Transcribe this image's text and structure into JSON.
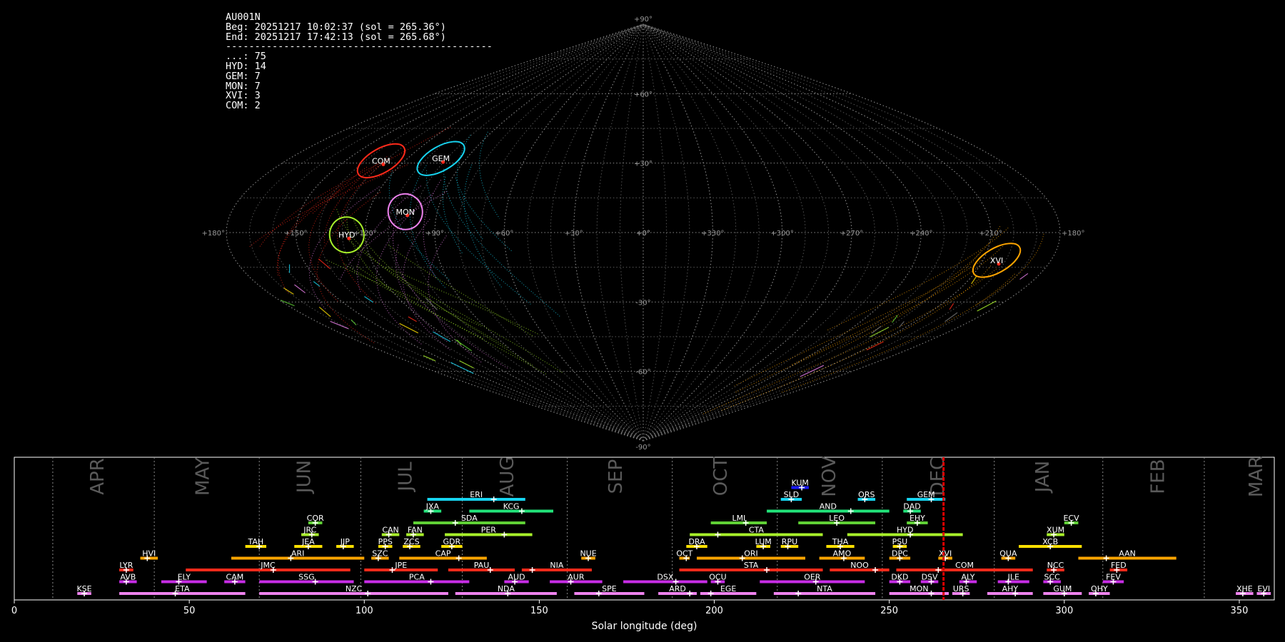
{
  "info": {
    "station": "AU001N",
    "begin": "Beg: 20251217 10:02:37 (sol = 265.36°)",
    "end": "End: 20251217 17:42:13 (sol = 265.68°)",
    "separator": "----------------------------------------------",
    "counts": [
      "...: 75",
      "HYD: 14",
      "GEM: 7",
      "MON: 7",
      "XVI: 3",
      "COM: 2"
    ]
  },
  "sky_map": {
    "projection": "sinusoidal",
    "lon_labels": [
      "+180°",
      "+150°",
      "+120°",
      "+90°",
      "+60°",
      "+30°",
      "+0°",
      "+330°",
      "+300°",
      "+270°",
      "+240°",
      "+210°",
      "+180°"
    ],
    "lat_labels": [
      "+90°",
      "+60°",
      "+30°",
      "+0°",
      "-30°",
      "-60°",
      "-90°"
    ],
    "showers": [
      {
        "code": "COM",
        "lon": 132,
        "lat": 31,
        "color": "#ff2a1a"
      },
      {
        "code": "GEM",
        "lon": 103,
        "lat": 32,
        "color": "#17d4f0"
      },
      {
        "code": "MON",
        "lon": 104,
        "lat": 9,
        "color": "#ee82ee"
      },
      {
        "code": "HYD",
        "lon": 128,
        "lat": -1,
        "color": "#a8f02a"
      },
      {
        "code": "XVI",
        "lon": 204,
        "lat": -12,
        "color": "#ffa500"
      }
    ]
  },
  "chart_data": {
    "type": "timeline",
    "xlabel": "Solar longitude (deg)",
    "xlim": [
      0,
      360
    ],
    "xticks": [
      0,
      50,
      100,
      150,
      200,
      250,
      300,
      350
    ],
    "current_sol": 265.5,
    "months": [
      {
        "label": "APR",
        "start": 11,
        "mid": 24
      },
      {
        "label": "MAY",
        "start": 40,
        "mid": 54
      },
      {
        "label": "JUN",
        "start": 70,
        "mid": 83
      },
      {
        "label": "JUL",
        "start": 99,
        "mid": 112
      },
      {
        "label": "AUG",
        "start": 128,
        "mid": 141
      },
      {
        "label": "SEP",
        "start": 158,
        "mid": 172
      },
      {
        "label": "OCT",
        "start": 188,
        "mid": 202
      },
      {
        "label": "NOV",
        "start": 218,
        "mid": 233
      },
      {
        "label": "DEC",
        "start": 248,
        "mid": 264
      },
      {
        "label": "JAN",
        "start": 280,
        "mid": 294
      },
      {
        "label": "FEB",
        "start": 311,
        "mid": 327
      },
      {
        "label": "MAR",
        "start": 340,
        "mid": 355
      }
    ],
    "showers": [
      {
        "code": "KUM",
        "start": 222,
        "end": 227,
        "peak": 225,
        "row": 9,
        "color": "#1a1aff"
      },
      {
        "code": "ERI",
        "start": 118,
        "end": 146,
        "peak": 137,
        "row": 8,
        "color": "#17d4f0"
      },
      {
        "code": "SLD",
        "start": 219,
        "end": 225,
        "peak": 222,
        "row": 8,
        "color": "#17d4f0"
      },
      {
        "code": "ORS",
        "start": 241,
        "end": 246,
        "peak": 243,
        "row": 8,
        "color": "#17d4f0"
      },
      {
        "code": "GEM",
        "start": 255,
        "end": 266,
        "peak": 262,
        "row": 8,
        "color": "#17d4f0"
      },
      {
        "code": "JXA",
        "start": 117,
        "end": 122,
        "peak": 119,
        "row": 7,
        "color": "#22e47a"
      },
      {
        "code": "KCG",
        "start": 130,
        "end": 154,
        "peak": 145,
        "row": 7,
        "color": "#22e47a"
      },
      {
        "code": "AND",
        "start": 215,
        "end": 250,
        "peak": 239,
        "row": 7,
        "color": "#22e47a"
      },
      {
        "code": "DAD",
        "start": 254,
        "end": 259,
        "peak": 256,
        "row": 7,
        "color": "#22e47a"
      },
      {
        "code": "COR",
        "start": 84,
        "end": 88,
        "peak": 86,
        "row": 6,
        "color": "#5fd035"
      },
      {
        "code": "SDA",
        "start": 114,
        "end": 146,
        "peak": 126,
        "row": 6,
        "color": "#5fd035"
      },
      {
        "code": "LMI",
        "start": 199,
        "end": 215,
        "peak": 209,
        "row": 6,
        "color": "#5fd035"
      },
      {
        "code": "LEO",
        "start": 224,
        "end": 246,
        "peak": 235,
        "row": 6,
        "color": "#5fd035"
      },
      {
        "code": "EHY",
        "start": 255,
        "end": 261,
        "peak": 258,
        "row": 6,
        "color": "#5fd035"
      },
      {
        "code": "ECV",
        "start": 300,
        "end": 304,
        "peak": 302,
        "row": 6,
        "color": "#5fd035"
      },
      {
        "code": "JRC",
        "start": 82,
        "end": 87,
        "peak": 85,
        "row": 5,
        "color": "#a8f02a"
      },
      {
        "code": "CAN",
        "start": 105,
        "end": 110,
        "peak": 107,
        "row": 5,
        "color": "#a8f02a"
      },
      {
        "code": "FAN",
        "start": 112,
        "end": 117,
        "peak": 114,
        "row": 5,
        "color": "#a8f02a"
      },
      {
        "code": "PER",
        "start": 123,
        "end": 148,
        "peak": 140,
        "row": 5,
        "color": "#a8f02a"
      },
      {
        "code": "CTA",
        "start": 193,
        "end": 231,
        "peak": 201,
        "row": 5,
        "color": "#a8f02a"
      },
      {
        "code": "HYD",
        "start": 238,
        "end": 271,
        "peak": 256,
        "row": 5,
        "color": "#a8f02a"
      },
      {
        "code": "XUM",
        "start": 295,
        "end": 300,
        "peak": 297,
        "row": 5,
        "color": "#a8f02a"
      },
      {
        "code": "TAH",
        "start": 66,
        "end": 72,
        "peak": 70,
        "row": 4,
        "color": "#ffe000"
      },
      {
        "code": "JEA",
        "start": 80,
        "end": 88,
        "peak": 84,
        "row": 4,
        "color": "#ffe000"
      },
      {
        "code": "JIP",
        "start": 92,
        "end": 97,
        "peak": 94,
        "row": 4,
        "color": "#ffe000"
      },
      {
        "code": "PPS",
        "start": 104,
        "end": 108,
        "peak": 106,
        "row": 4,
        "color": "#ffe000"
      },
      {
        "code": "ZCS",
        "start": 111,
        "end": 116,
        "peak": 113,
        "row": 4,
        "color": "#ffe000"
      },
      {
        "code": "GDR",
        "start": 122,
        "end": 128,
        "peak": 125,
        "row": 4,
        "color": "#ffe000"
      },
      {
        "code": "DRA",
        "start": 192,
        "end": 198,
        "peak": 195,
        "row": 4,
        "color": "#ffe000"
      },
      {
        "code": "LUM",
        "start": 212,
        "end": 216,
        "peak": 214,
        "row": 4,
        "color": "#ffe000"
      },
      {
        "code": "RPU",
        "start": 219,
        "end": 224,
        "peak": 221,
        "row": 4,
        "color": "#ffe000"
      },
      {
        "code": "THA",
        "start": 232,
        "end": 240,
        "peak": 236,
        "row": 4,
        "color": "#ffe000"
      },
      {
        "code": "PSU",
        "start": 251,
        "end": 255,
        "peak": 253,
        "row": 4,
        "color": "#ffe000"
      },
      {
        "code": "XCB",
        "start": 287,
        "end": 305,
        "peak": 296,
        "row": 4,
        "color": "#ffe000"
      },
      {
        "code": "HVI",
        "start": 36,
        "end": 41,
        "peak": 38,
        "row": 3,
        "color": "#ffa500"
      },
      {
        "code": "ARI",
        "start": 62,
        "end": 100,
        "peak": 79,
        "row": 3,
        "color": "#ffa500"
      },
      {
        "code": "SZC",
        "start": 102,
        "end": 107,
        "peak": 104,
        "row": 3,
        "color": "#ffa500"
      },
      {
        "code": "CAP",
        "start": 110,
        "end": 135,
        "peak": 127,
        "row": 3,
        "color": "#ffa500"
      },
      {
        "code": "NUE",
        "start": 162,
        "end": 166,
        "peak": 164,
        "row": 3,
        "color": "#ffa500"
      },
      {
        "code": "OCT",
        "start": 190,
        "end": 193,
        "peak": 192,
        "row": 3,
        "color": "#ffa500"
      },
      {
        "code": "ORI",
        "start": 195,
        "end": 226,
        "peak": 208,
        "row": 3,
        "color": "#ffa500"
      },
      {
        "code": "AMO",
        "start": 230,
        "end": 243,
        "peak": 237,
        "row": 3,
        "color": "#ffa500"
      },
      {
        "code": "DPC",
        "start": 250,
        "end": 256,
        "peak": 253,
        "row": 3,
        "color": "#ffa500"
      },
      {
        "code": "XVI",
        "start": 264,
        "end": 268,
        "peak": 266,
        "row": 3,
        "color": "#ffa500"
      },
      {
        "code": "QUA",
        "start": 282,
        "end": 286,
        "peak": 284,
        "row": 3,
        "color": "#ffa500"
      },
      {
        "code": "AAN",
        "start": 304,
        "end": 332,
        "peak": 312,
        "row": 3,
        "color": "#ffa500"
      },
      {
        "code": "LYR",
        "start": 30,
        "end": 34,
        "peak": 32,
        "row": 2,
        "color": "#ff2a1a"
      },
      {
        "code": "JMC",
        "start": 49,
        "end": 96,
        "peak": 74,
        "row": 2,
        "color": "#ff2a1a"
      },
      {
        "code": "JPE",
        "start": 100,
        "end": 121,
        "peak": 108,
        "row": 2,
        "color": "#ff2a1a"
      },
      {
        "code": "PAU",
        "start": 124,
        "end": 143,
        "peak": 136,
        "row": 2,
        "color": "#ff2a1a"
      },
      {
        "code": "NIA",
        "start": 145,
        "end": 165,
        "peak": 148,
        "row": 2,
        "color": "#ff2a1a"
      },
      {
        "code": "STA",
        "start": 190,
        "end": 231,
        "peak": 215,
        "row": 2,
        "color": "#ff2a1a"
      },
      {
        "code": "NOO",
        "start": 233,
        "end": 250,
        "peak": 246,
        "row": 2,
        "color": "#ff2a1a"
      },
      {
        "code": "COM",
        "start": 252,
        "end": 291,
        "peak": 264,
        "row": 2,
        "color": "#ff2a1a"
      },
      {
        "code": "NCC",
        "start": 295,
        "end": 300,
        "peak": 297,
        "row": 2,
        "color": "#ff2a1a"
      },
      {
        "code": "FED",
        "start": 313,
        "end": 318,
        "peak": 315,
        "row": 2,
        "color": "#ff2a1a"
      },
      {
        "code": "AVB",
        "start": 30,
        "end": 35,
        "peak": 32,
        "row": 1,
        "color": "#c82de6"
      },
      {
        "code": "ELY",
        "start": 42,
        "end": 55,
        "peak": 47,
        "row": 1,
        "color": "#c82de6"
      },
      {
        "code": "CAM",
        "start": 60,
        "end": 66,
        "peak": 63,
        "row": 1,
        "color": "#c82de6"
      },
      {
        "code": "SSG",
        "start": 70,
        "end": 97,
        "peak": 86,
        "row": 1,
        "color": "#c82de6"
      },
      {
        "code": "PCA",
        "start": 100,
        "end": 130,
        "peak": 119,
        "row": 1,
        "color": "#c82de6"
      },
      {
        "code": "AUD",
        "start": 140,
        "end": 147,
        "peak": 143,
        "row": 1,
        "color": "#c82de6"
      },
      {
        "code": "AUR",
        "start": 153,
        "end": 168,
        "peak": 159,
        "row": 1,
        "color": "#c82de6"
      },
      {
        "code": "DSX",
        "start": 174,
        "end": 198,
        "peak": 189,
        "row": 1,
        "color": "#c82de6"
      },
      {
        "code": "OCU",
        "start": 199,
        "end": 203,
        "peak": 201,
        "row": 1,
        "color": "#c82de6"
      },
      {
        "code": "OER",
        "start": 213,
        "end": 243,
        "peak": 229,
        "row": 1,
        "color": "#c82de6"
      },
      {
        "code": "DKD",
        "start": 250,
        "end": 256,
        "peak": 253,
        "row": 1,
        "color": "#c82de6"
      },
      {
        "code": "DSV",
        "start": 259,
        "end": 264,
        "peak": 262,
        "row": 1,
        "color": "#c82de6"
      },
      {
        "code": "ALY",
        "start": 270,
        "end": 275,
        "peak": 272,
        "row": 1,
        "color": "#c82de6"
      },
      {
        "code": "JLE",
        "start": 281,
        "end": 290,
        "peak": 284,
        "row": 1,
        "color": "#c82de6"
      },
      {
        "code": "SCC",
        "start": 294,
        "end": 299,
        "peak": 296,
        "row": 1,
        "color": "#c82de6"
      },
      {
        "code": "FEV",
        "start": 311,
        "end": 317,
        "peak": 314,
        "row": 1,
        "color": "#c82de6"
      },
      {
        "code": "KSE",
        "start": 18,
        "end": 22,
        "peak": 20,
        "row": 0,
        "color": "#ee82ee"
      },
      {
        "code": "ETA",
        "start": 30,
        "end": 66,
        "peak": 46,
        "row": 0,
        "color": "#ee82ee"
      },
      {
        "code": "NZC",
        "start": 70,
        "end": 124,
        "peak": 101,
        "row": 0,
        "color": "#ee82ee"
      },
      {
        "code": "NDA",
        "start": 126,
        "end": 155,
        "peak": 141,
        "row": 0,
        "color": "#ee82ee"
      },
      {
        "code": "SPE",
        "start": 160,
        "end": 180,
        "peak": 167,
        "row": 0,
        "color": "#ee82ee"
      },
      {
        "code": "ARD",
        "start": 184,
        "end": 195,
        "peak": 193,
        "row": 0,
        "color": "#ee82ee"
      },
      {
        "code": "EGE",
        "start": 196,
        "end": 212,
        "peak": 199,
        "row": 0,
        "color": "#ee82ee"
      },
      {
        "code": "NTA",
        "start": 217,
        "end": 246,
        "peak": 224,
        "row": 0,
        "color": "#ee82ee"
      },
      {
        "code": "MON",
        "start": 250,
        "end": 267,
        "peak": 262,
        "row": 0,
        "color": "#ee82ee"
      },
      {
        "code": "URS",
        "start": 268,
        "end": 273,
        "peak": 271,
        "row": 0,
        "color": "#ee82ee"
      },
      {
        "code": "AHY",
        "start": 278,
        "end": 291,
        "peak": 286,
        "row": 0,
        "color": "#ee82ee"
      },
      {
        "code": "GUM",
        "start": 294,
        "end": 305,
        "peak": 300,
        "row": 0,
        "color": "#ee82ee"
      },
      {
        "code": "OHY",
        "start": 307,
        "end": 313,
        "peak": 309,
        "row": 0,
        "color": "#ee82ee"
      },
      {
        "code": "XHE",
        "start": 349,
        "end": 354,
        "peak": 351,
        "row": 0,
        "color": "#ee82ee"
      },
      {
        "code": "EVI",
        "start": 355,
        "end": 359,
        "peak": 357,
        "row": 0,
        "color": "#ee82ee"
      }
    ]
  }
}
